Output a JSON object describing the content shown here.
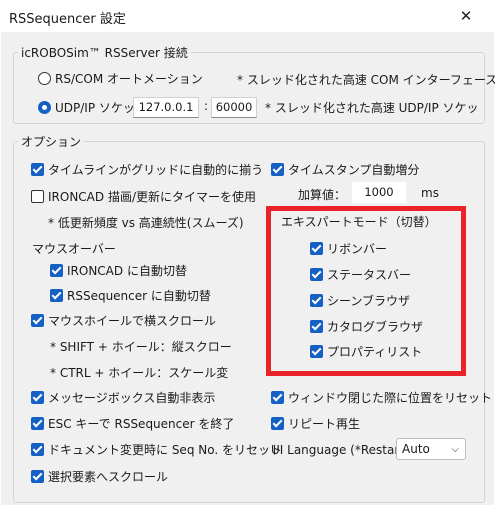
{
  "window": {
    "title": "RSSequencer 設定",
    "close_label": "✕"
  },
  "server_group": {
    "legend": "icROBOSim™ RSServer 接続",
    "rs_com": {
      "label": "RS/COM オートメーション",
      "note": "* スレッド化された高速 COM インターフェース",
      "selected": false
    },
    "udp_ip": {
      "label": "UDP/IP ソケット",
      "ip": "127.0.0.1",
      "separator": ":",
      "port": "60000",
      "note": "* スレッド化された高速 UDP/IP ソケッ",
      "selected": true
    }
  },
  "options_group": {
    "legend": "オプション",
    "timeline_snap": {
      "label": "タイムラインがグリッドに自動的に揃う",
      "checked": true
    },
    "timestamp_auto": {
      "label": "タイムスタンプ自動増分",
      "checked": true
    },
    "increment": {
      "label": "加算値：",
      "value": "1000",
      "unit": "ms"
    },
    "ironcad_timer": {
      "label": "IRONCAD 描画/更新にタイマーを使用",
      "checked": false
    },
    "timer_note": "* 低更新頻度 vs 高連続性(スムーズ)",
    "mouseover": {
      "heading": "マウスオーバー",
      "ironcad_switch": {
        "label": "IRONCAD に自動切替",
        "checked": true
      },
      "rssequencer_switch": {
        "label": "RSSequencer に自動切替",
        "checked": true
      }
    },
    "expert_mode": {
      "heading": "エキスパートモード（切替）",
      "items": [
        {
          "label": "リボンバー",
          "checked": true
        },
        {
          "label": "ステータスバー",
          "checked": true
        },
        {
          "label": "シーンブラウザ",
          "checked": true
        },
        {
          "label": "カタログブラウザ",
          "checked": true
        },
        {
          "label": "プロパティリスト",
          "checked": true
        }
      ],
      "highlight_color": "#e8232a"
    },
    "wheel_scroll": {
      "label": "マウスホイールで横スクロール",
      "checked": true
    },
    "shift_note": "* SHIFT + ホイール：縦スクロー",
    "ctrl_note": "* CTRL + ホイール：スケール変",
    "msgbox_hide": {
      "label": "メッセージボックス自動非表示",
      "checked": true
    },
    "save_position": {
      "label": "ウィンドウ閉じた際に位置をリセット",
      "checked": true
    },
    "esc_exit": {
      "label": "ESC キーで RSSequencer を終了",
      "checked": true
    },
    "repeat_play": {
      "label": "リピート再生",
      "checked": true
    },
    "reset_seq": {
      "label": "ドキュメント変更時に Seq No. をリセット",
      "checked": true
    },
    "ui_language": {
      "label": "UI Language (*Restart):",
      "value": "Auto"
    },
    "scroll_selected": {
      "label": "選択要素へスクロール",
      "checked": true
    }
  },
  "colors": {
    "accent": "#1460c4",
    "background": "#f0f0f0"
  }
}
